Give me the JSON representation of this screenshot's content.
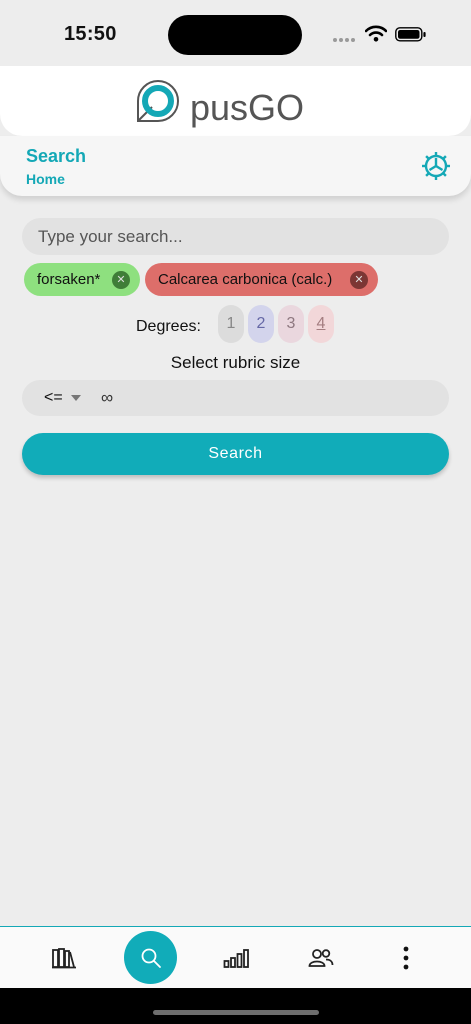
{
  "status_bar": {
    "time": "15:50"
  },
  "app": {
    "logo_text": "pusGO",
    "accent_color": "#14a8b6"
  },
  "title_bar": {
    "title": "Search",
    "breadcrumb": "Home"
  },
  "search": {
    "placeholder": "Type your search...",
    "value": ""
  },
  "chips": [
    {
      "label": "forsaken*",
      "color": "#8ee07f"
    },
    {
      "label": "Calcarea carbonica (calc.)",
      "color": "#dd6e6a"
    }
  ],
  "degrees": {
    "label": "Degrees:",
    "options": [
      "1",
      "2",
      "3",
      "4"
    ]
  },
  "rubric_size": {
    "label": "Select rubric size",
    "operator": "<=",
    "value": "∞"
  },
  "search_button": {
    "label": "Search"
  },
  "bottom_nav": [
    {
      "icon": "library-icon"
    },
    {
      "icon": "search-icon",
      "active": true
    },
    {
      "icon": "stats-icon"
    },
    {
      "icon": "users-icon"
    },
    {
      "icon": "more-icon"
    }
  ]
}
